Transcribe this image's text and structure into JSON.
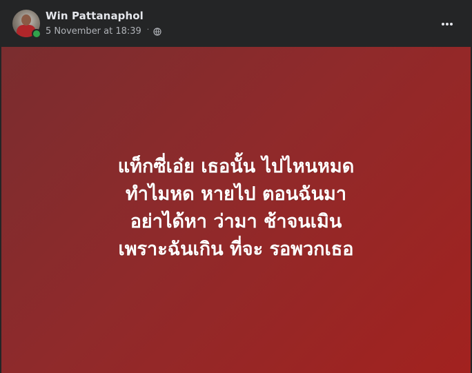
{
  "post": {
    "author_name": "Win Pattanaphol",
    "timestamp": "5 November at 18:39",
    "separator": "·",
    "audience_icon": "globe-icon",
    "more_icon": "more-options-icon",
    "lines": [
      "แท็กซี่เอ๋ย เธอนั้น ไปไหนหมด",
      "ทำไมหด หายไป ตอนฉันมา",
      "อย่าได้หา ว่ามา ช้าจนเมิน",
      "เพราะฉันเกิน ที่จะ รอพวกเธอ"
    ],
    "background_colors": {
      "start": "#7a2d2f",
      "end": "#a2221f"
    },
    "online": true
  }
}
